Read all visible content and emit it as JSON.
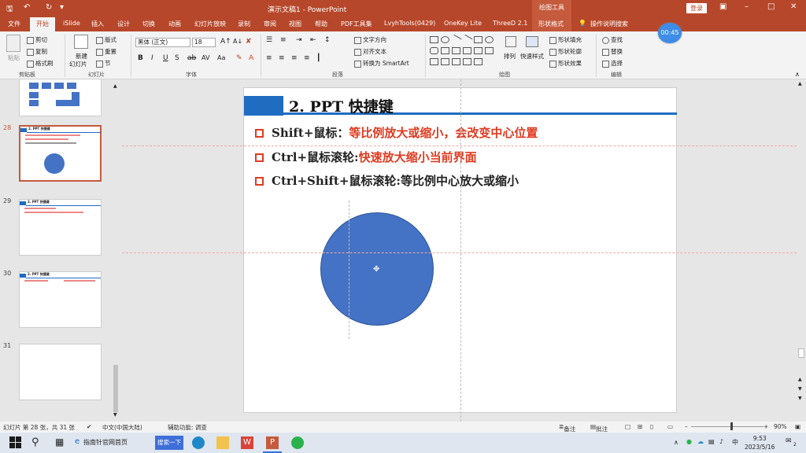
{
  "title_bar": {
    "doc_title": "演示文稿1  -  PowerPoint",
    "drawing_tools": "绘图工具",
    "login": "登录"
  },
  "tabs": [
    "文件",
    "开始",
    "iSlide",
    "插入",
    "设计",
    "切换",
    "动画",
    "幻灯片放映",
    "录制",
    "审阅",
    "视图",
    "帮助",
    "PDF工具集",
    "LvyhTools(0429)",
    "OneKey Lite",
    "ThreeD 2.1",
    "形状格式",
    "操作说明搜索"
  ],
  "timer": "00:45",
  "ribbon": {
    "clipboard": {
      "paste": "粘贴",
      "cut": "剪切",
      "copy": "复制",
      "format_painter": "格式刷",
      "label": "剪贴板"
    },
    "slides": {
      "new_slide": "新建",
      "new_slide2": "幻灯片",
      "layout": "版式",
      "reset": "重置",
      "section": "节",
      "label": "幻灯片"
    },
    "font": {
      "font_name": "黑体 (正文)",
      "font_size": "18",
      "label": "字体"
    },
    "paragraph": {
      "text_direction": "文字方向",
      "align_text": "对齐文本",
      "smartart": "转换为 SmartArt",
      "label": "段落"
    },
    "drawing": {
      "arrange": "排列",
      "quick_styles": "快速样式",
      "shape_fill": "形状填充",
      "shape_outline": "形状轮廓",
      "shape_effects": "形状效果",
      "label": "绘图"
    },
    "editing": {
      "find": "查找",
      "replace": "替换",
      "select": "选择",
      "label": "编辑"
    }
  },
  "slide_panel": {
    "numbers": [
      "28",
      "29",
      "30",
      "31"
    ],
    "thumb28_title": "2. PPT 快捷键",
    "thumb29_title": "2. PPT 快捷键",
    "thumb30_title": "2. PPT 快捷键"
  },
  "slide": {
    "title": "2. PPT 快捷键",
    "bullets": [
      {
        "prefix": "Shift+鼠标：",
        "emph": "等比例放大或缩小，会改变中心位置",
        "suffix": ""
      },
      {
        "prefix": "Ctrl+鼠标滚轮:",
        "emph": "快速放大缩小当前界面",
        "suffix": ""
      },
      {
        "prefix": "Ctrl+Shift+鼠标滚轮:",
        "emph": "",
        "suffix": "等比例中心放大或缩小"
      }
    ],
    "circle_color": "#4472c4",
    "accent_color": "#1f6cc1"
  },
  "status_bar": {
    "slide_info": "幻灯片 第 28 张，共 31 张",
    "language": "中文(中国大陆)",
    "accessibility": "辅助功能: 调查",
    "notes": "备注",
    "comments": "批注",
    "zoom": "90%"
  },
  "taskbar": {
    "browser_tab": "指南针官网首页",
    "search_button": "搜索一下",
    "ime": "中",
    "time": "9:53",
    "date": "2023/5/16",
    "notification_count": "2"
  }
}
